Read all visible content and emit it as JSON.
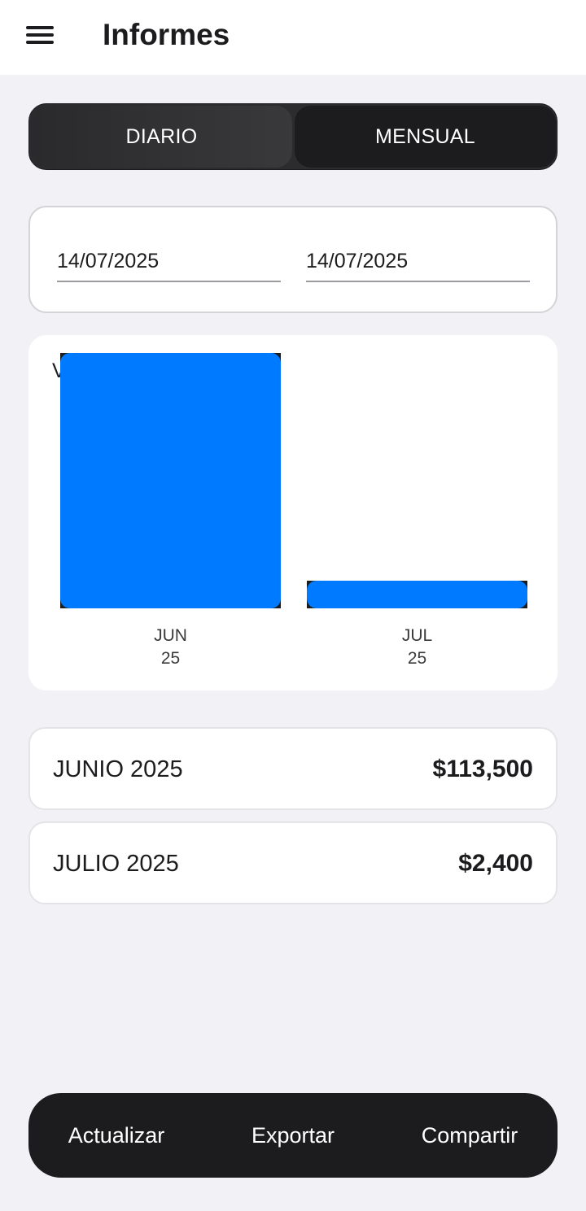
{
  "header": {
    "menu_icon": "hamburger-menu-icon",
    "title": "Informes"
  },
  "segmented": {
    "daily_label": "DIARIO",
    "monthly_label": "MENSUAL",
    "selected": "MENSUAL"
  },
  "dates": {
    "from": "14/07/2025",
    "to": "14/07/2025"
  },
  "chart_cut_label": "V",
  "chart_data": {
    "type": "bar",
    "categories": [
      "JUN\n25",
      "JUL\n25"
    ],
    "category_lines": [
      [
        "JUN",
        "25"
      ],
      [
        "JUL",
        "25"
      ]
    ],
    "values": [
      113500,
      2400
    ],
    "bar_color": "#007AFF",
    "ylim": [
      0,
      113500
    ],
    "grid": false
  },
  "rows": [
    {
      "label": "JUNIO 2025",
      "amount": "$113,500"
    },
    {
      "label": "JULIO 2025",
      "amount": "$2,400"
    }
  ],
  "actions": {
    "refresh": "Actualizar",
    "export": "Exportar",
    "share": "Compartir"
  }
}
